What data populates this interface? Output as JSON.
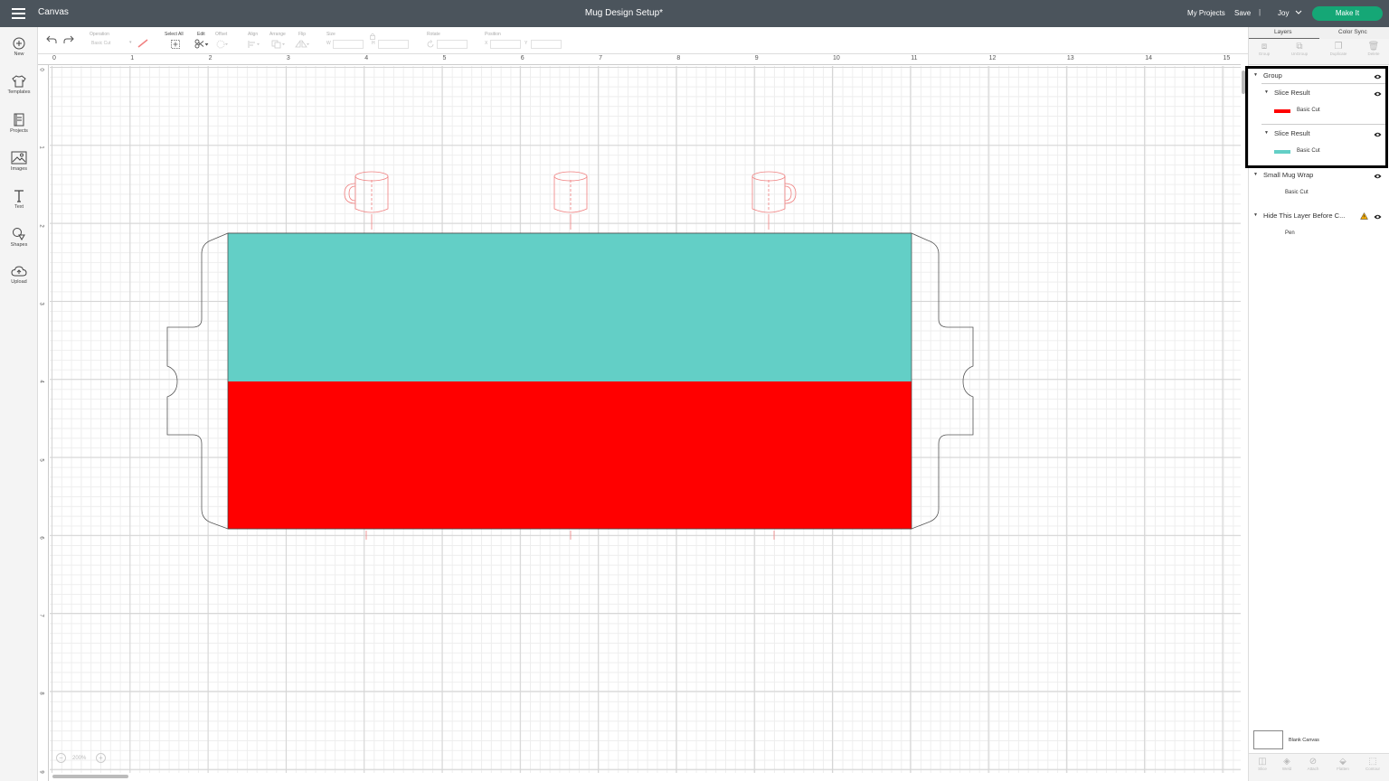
{
  "topbar": {
    "app_title": "Canvas",
    "doc_title": "Mug Design Setup*",
    "my_projects": "My Projects",
    "save": "Save",
    "separator": "|",
    "user": "Joy",
    "make_it": "Make It",
    "make_it_color": "#15a776"
  },
  "sidebar": {
    "new": "New",
    "templates": "Templates",
    "projects": "Projects",
    "images": "Images",
    "text": "Text",
    "shapes": "Shapes",
    "upload": "Upload"
  },
  "toolbar": {
    "operation_label": "Operation",
    "operation_value": "Basic Cut",
    "select_all": "Select All",
    "edit": "Edit",
    "offset": "Offset",
    "align": "Align",
    "arrange": "Arrange",
    "flip": "Flip",
    "size": "Size",
    "w": "W",
    "h": "H",
    "rotate": "Rotate",
    "position": "Position",
    "x": "X",
    "y": "Y"
  },
  "ruler": {
    "top": [
      "0",
      "1",
      "2",
      "3",
      "4",
      "5",
      "6",
      "7",
      "8",
      "9",
      "10",
      "11",
      "12",
      "13",
      "14",
      "15"
    ],
    "left": [
      "0",
      "1",
      "2",
      "3",
      "4",
      "5",
      "6",
      "7",
      "8",
      "9"
    ]
  },
  "zoom": {
    "minus": "−",
    "plus": "+",
    "value": "200%"
  },
  "panel": {
    "tabs": [
      "Layers",
      "Color Sync"
    ],
    "tools": [
      "Group",
      "UnGroup",
      "Duplicate",
      "Delete"
    ],
    "layers": {
      "group": "Group",
      "slice1": "Slice Result",
      "slice1_op": "Basic Cut",
      "slice1_color": "#ff0000",
      "slice2": "Slice Result",
      "slice2_op": "Basic Cut",
      "slice2_color": "#63cfc6",
      "mug_wrap": "Small Mug Wrap",
      "mug_wrap_op": "Basic Cut",
      "hide_layer": "Hide This Layer Before C...",
      "hide_layer_op": "Pen"
    },
    "blank_canvas": "Blank Canvas",
    "bottom_tools": [
      "Slice",
      "Weld",
      "Attach",
      "Flatten",
      "Contour"
    ]
  },
  "design": {
    "teal": "#63cfc6",
    "red": "#ff0000",
    "guide": "#f08080",
    "outline": "#555555"
  }
}
